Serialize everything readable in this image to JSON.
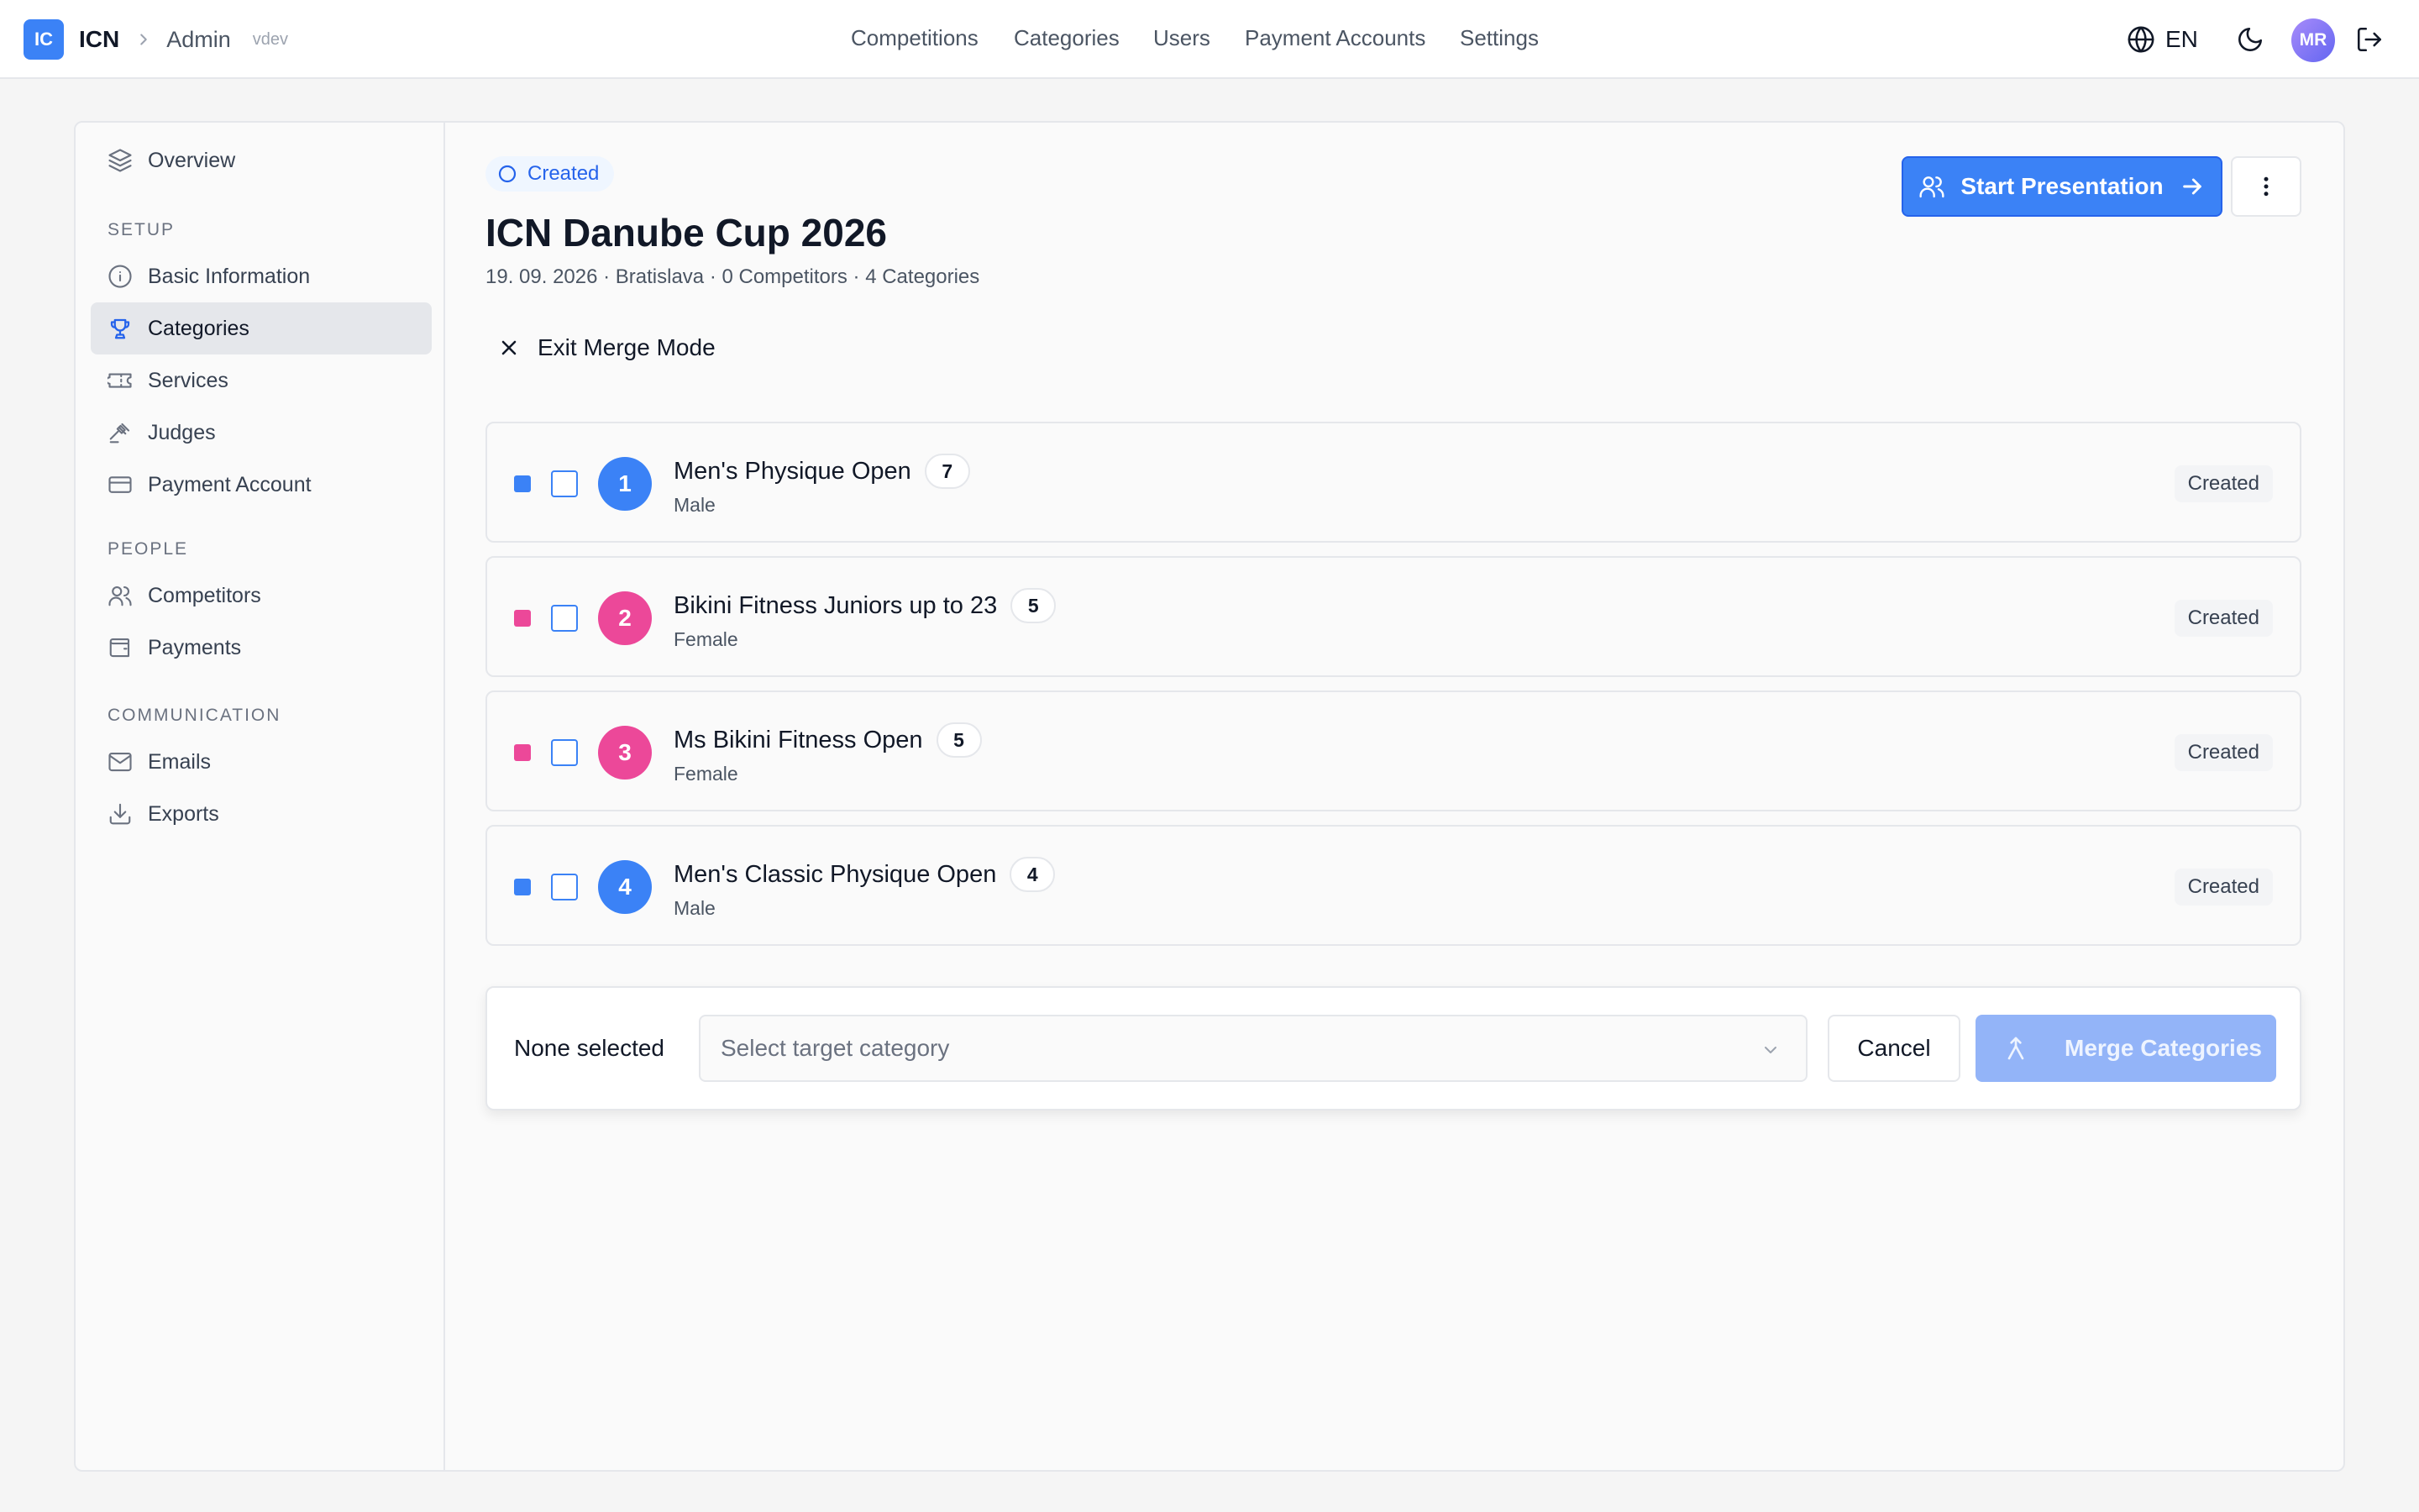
{
  "brand": {
    "logo": "IC",
    "name": "ICN",
    "section": "Admin",
    "version": "vdev"
  },
  "topnav": [
    "Competitions",
    "Categories",
    "Users",
    "Payment Accounts",
    "Settings"
  ],
  "header_right": {
    "language": "EN",
    "avatar_initials": "MR"
  },
  "sidebar": {
    "overview": "Overview",
    "setup_heading": "SETUP",
    "setup": [
      "Basic Information",
      "Categories",
      "Services",
      "Judges",
      "Payment Account"
    ],
    "people_heading": "PEOPLE",
    "people": [
      "Competitors",
      "Payments"
    ],
    "communication_heading": "COMMUNICATION",
    "communication": [
      "Emails",
      "Exports"
    ],
    "active": "Categories"
  },
  "competition": {
    "status": "Created",
    "title": "ICN Danube Cup 2026",
    "meta": "19. 09. 2026 · Bratislava · 0 Competitors · 4 Categories"
  },
  "actions": {
    "start_presentation": "Start Presentation",
    "exit_merge": "Exit Merge Mode"
  },
  "categories": [
    {
      "number": "1",
      "name": "Men's Physique Open",
      "count": "7",
      "gender": "Male",
      "status": "Created",
      "color": "#3b82f6"
    },
    {
      "number": "2",
      "name": "Bikini Fitness Juniors up to 23",
      "count": "5",
      "gender": "Female",
      "status": "Created",
      "color": "#ec4899"
    },
    {
      "number": "3",
      "name": "Ms Bikini Fitness Open",
      "count": "5",
      "gender": "Female",
      "status": "Created",
      "color": "#ec4899"
    },
    {
      "number": "4",
      "name": "Men's Classic Physique Open",
      "count": "4",
      "gender": "Male",
      "status": "Created",
      "color": "#3b82f6"
    }
  ],
  "merge": {
    "selection": "None selected",
    "target_placeholder": "Select target category",
    "cancel": "Cancel",
    "merge": "Merge Categories"
  },
  "colors": {
    "accent": "#3b82f6",
    "male": "#3b82f6",
    "female": "#ec4899"
  }
}
